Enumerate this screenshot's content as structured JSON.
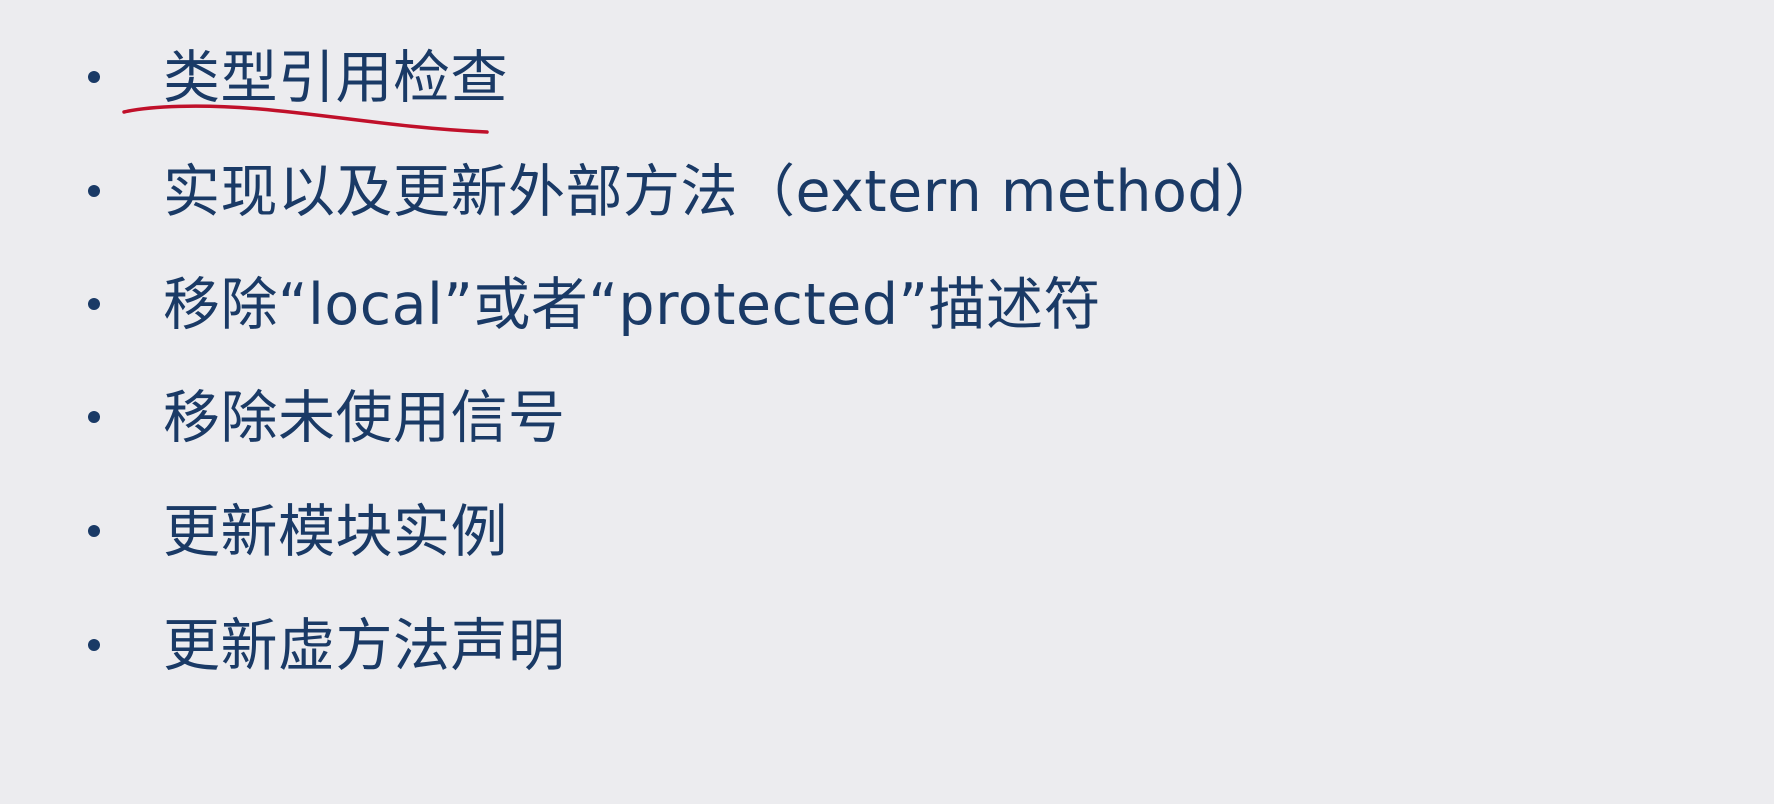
{
  "bullets": [
    "类型引用检查",
    "实现以及更新外部方法（extern method）",
    "移除“local”或者“protected”描述符",
    "移除未使用信号",
    "更新模块实例",
    "更新虚方法声明"
  ],
  "colors": {
    "background": "#ececef",
    "text": "#1a3a66",
    "annotation": "#c0102a"
  }
}
